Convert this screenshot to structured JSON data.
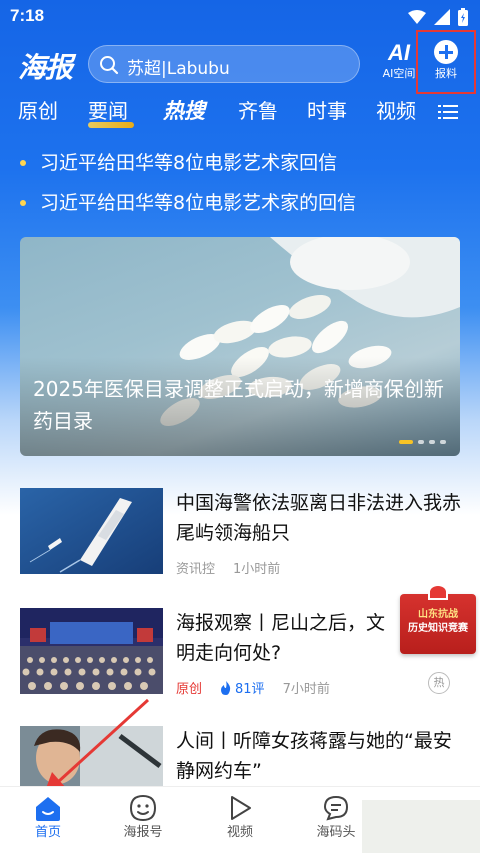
{
  "status_bar": {
    "time": "7:18"
  },
  "top_bar": {
    "logo": "海报",
    "search": {
      "value": "苏超|Labubu"
    },
    "ai_space": {
      "logo": "AI",
      "label": "AI空间"
    },
    "report": {
      "label": "报料"
    }
  },
  "channel_tabs": [
    "原创",
    "要闻",
    "热搜",
    "齐鲁",
    "时事",
    "视频"
  ],
  "headlines": [
    "习近平给田华等8位电影艺术家回信",
    "习近平给田华等8位电影艺术家的回信"
  ],
  "banner": {
    "title": "2025年医保目录调整正式启动，新增商保创新药目录",
    "pages": 4,
    "active_page": 1
  },
  "news": [
    {
      "title": "中国海警依法驱离日非法进入我赤尾屿领海船只",
      "source": "资讯控",
      "time": "1小时前"
    },
    {
      "title": "海报观察丨尼山之后，文明走向何处?",
      "source": "原创",
      "comments": "81评",
      "time": "7小时前"
    },
    {
      "title": "人间丨听障女孩蒋露与她的“最安静网约车”"
    }
  ],
  "float_badge": {
    "line1": "山东抗战",
    "line2": "历史知识竞赛"
  },
  "hot_mark": "热",
  "bottom_nav": [
    {
      "label": "首页",
      "icon": "home-icon",
      "active": true
    },
    {
      "label": "海报号",
      "icon": "face-icon",
      "active": false
    },
    {
      "label": "视频",
      "icon": "play-icon",
      "active": false
    },
    {
      "label": "海码头",
      "icon": "chat-icon",
      "active": false
    }
  ],
  "colors": {
    "brand_blue": "#1d6ff0",
    "highlight_red": "#e53935",
    "accent_yellow": "#f7c325"
  }
}
